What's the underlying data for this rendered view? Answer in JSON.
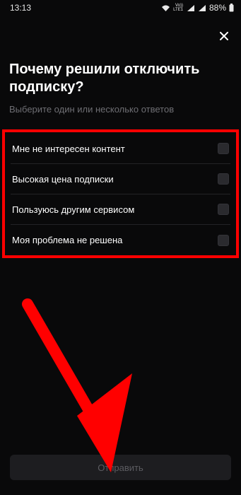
{
  "status_bar": {
    "time": "13:13",
    "network_top": "Vo))",
    "network_bottom": "LTE1",
    "battery": "88%",
    "icons": [
      "wifi-icon",
      "signal-icon",
      "battery-icon"
    ]
  },
  "title": "Почему решили отключить подписку?",
  "subtitle": "Выберите один или несколько ответов",
  "options": [
    {
      "label": "Мне не интересен контент",
      "checked": false
    },
    {
      "label": "Высокая цена подписки",
      "checked": false
    },
    {
      "label": "Пользуюсь другим сервисом",
      "checked": false
    },
    {
      "label": "Моя проблема не решена",
      "checked": false
    }
  ],
  "submit_label": "Отправить",
  "colors": {
    "background": "#09090a",
    "highlight": "#ff0000",
    "muted_text": "#6e6e73",
    "button_bg": "#1d1d20"
  }
}
